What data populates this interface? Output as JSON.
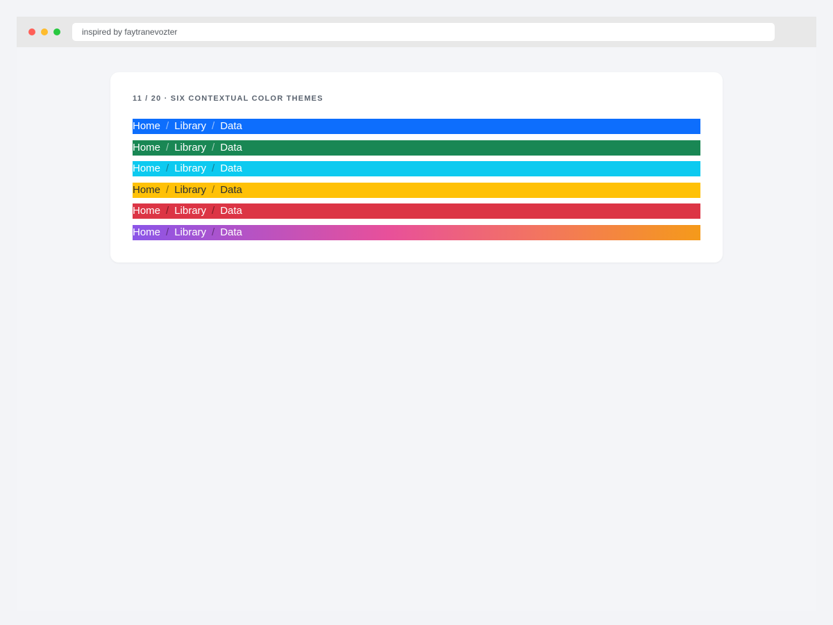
{
  "browser": {
    "url_text": "inspired by faytranevozter"
  },
  "card": {
    "title": "11 / 20 · SIX CONTEXTUAL COLOR THEMES"
  },
  "breadcrumbs": [
    {
      "theme": "primary",
      "color": "#0d6efd",
      "items": [
        "Home",
        "Library",
        "Data"
      ],
      "separator": "/"
    },
    {
      "theme": "success",
      "color": "#198754",
      "items": [
        "Home",
        "Library",
        "Data"
      ],
      "separator": "/"
    },
    {
      "theme": "info",
      "color": "#0dcaf0",
      "items": [
        "Home",
        "Library",
        "Data"
      ],
      "separator": "/"
    },
    {
      "theme": "warning",
      "color": "#ffc107",
      "items": [
        "Home",
        "Library",
        "Data"
      ],
      "separator": "/"
    },
    {
      "theme": "danger",
      "color": "#dc3545",
      "items": [
        "Home",
        "Library",
        "Data"
      ],
      "separator": "/"
    },
    {
      "theme": "gradient",
      "color": "#8b55e8",
      "items": [
        "Home",
        "Library",
        "Data"
      ],
      "separator": "/"
    }
  ]
}
